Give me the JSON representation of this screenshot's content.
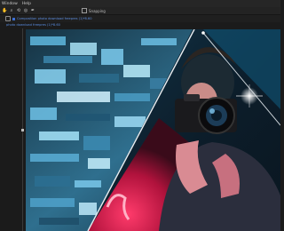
{
  "menu": {
    "window": "Window",
    "help": "Help"
  },
  "toolbar": {
    "tools": [
      {
        "name": "hand-tool-icon",
        "glyph": "✋"
      },
      {
        "name": "zoom-tool-icon",
        "glyph": "⌕"
      },
      {
        "name": "rotate-tool-icon",
        "glyph": "⟲"
      },
      {
        "name": "camera-tool-icon",
        "glyph": "◎"
      },
      {
        "name": "pen-tool-icon",
        "glyph": "✒"
      }
    ],
    "snapping_label": "Snapping"
  },
  "composition": {
    "tab_label": "Composition photo download freepres (1)*8.60",
    "breadcrumb": "photo download freepres (1)*8.60"
  },
  "colors": {
    "accent_blue": "#3b6fd6",
    "glitch_cyan": "#4fb6e0",
    "neon_pink": "#ff2e63"
  }
}
